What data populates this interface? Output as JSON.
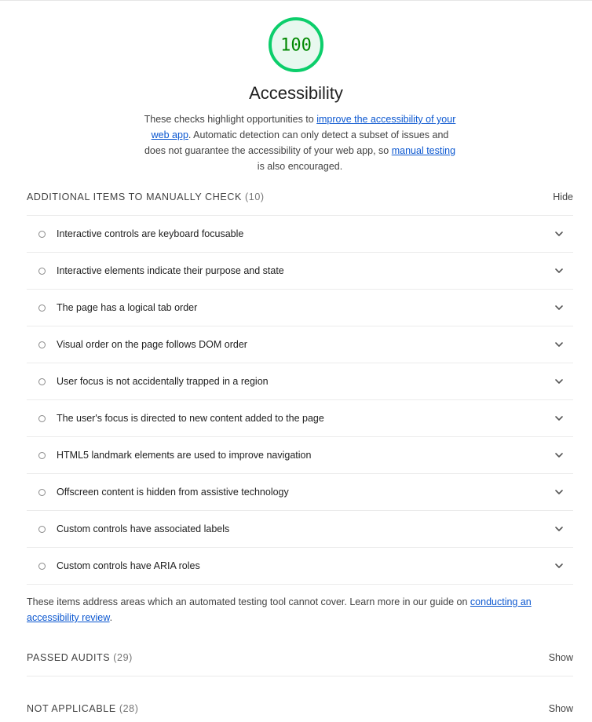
{
  "gauge": {
    "score": 100,
    "score_text": "100",
    "color": "#0cce6b",
    "text_color": "#008800"
  },
  "category": {
    "title": "Accessibility",
    "desc_part1": "These checks highlight opportunities to ",
    "desc_link1": "improve the accessibility of your web app",
    "desc_part2": ". Automatic detection can only detect a subset of issues and does not guarantee the accessibility of your web app, so ",
    "desc_link2": "manual testing",
    "desc_part3": " is also encouraged."
  },
  "manual_group": {
    "title": "ADDITIONAL ITEMS TO MANUALLY CHECK",
    "count": "(10)",
    "toggle": "Hide",
    "items": [
      "Interactive controls are keyboard focusable",
      "Interactive elements indicate their purpose and state",
      "The page has a logical tab order",
      "Visual order on the page follows DOM order",
      "User focus is not accidentally trapped in a region",
      "The user's focus is directed to new content added to the page",
      "HTML5 landmark elements are used to improve navigation",
      "Offscreen content is hidden from assistive technology",
      "Custom controls have associated labels",
      "Custom controls have ARIA roles"
    ],
    "footer_part1": "These items address areas which an automated testing tool cannot cover. Learn more in our guide on ",
    "footer_link": "conducting an accessibility review",
    "footer_part2": "."
  },
  "passed_group": {
    "title": "PASSED AUDITS",
    "count": "(29)",
    "toggle": "Show"
  },
  "na_group": {
    "title": "NOT APPLICABLE",
    "count": "(28)",
    "toggle": "Show"
  },
  "icons": {
    "bullet": "circle-icon",
    "expand": "chevron-down-icon"
  }
}
